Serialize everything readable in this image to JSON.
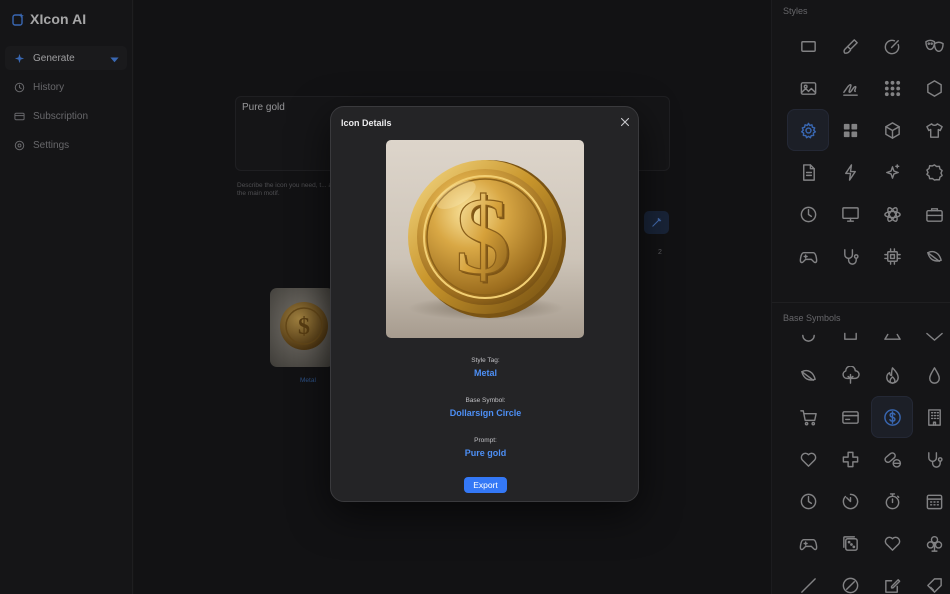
{
  "app": {
    "name": "XIcon AI",
    "icon": "app-logo-icon"
  },
  "sidebar": {
    "items": [
      {
        "label": "Generate",
        "icon": "sparkle-icon",
        "active": true
      },
      {
        "label": "History",
        "icon": "clock-history-icon",
        "active": false
      },
      {
        "label": "Subscription",
        "icon": "credit-card-icon",
        "active": false
      },
      {
        "label": "Settings",
        "icon": "gear-icon",
        "active": false
      }
    ]
  },
  "main": {
    "prompt_value": "Pure gold",
    "hint_text": "Describe the icon you need, t... as the main motif.",
    "count_label": "2",
    "result": {
      "label": "Metal"
    }
  },
  "right_panel": {
    "styles_title": "Styles",
    "styles_selected": "gear-icon",
    "base_symbols_title": "Base Symbols",
    "base_symbols_selected": "dollarsign-circle-icon"
  },
  "modal": {
    "title": "Icon Details",
    "style_tag_label": "Style Tag:",
    "style_tag_value": "Metal",
    "base_symbol_label": "Base Symbol:",
    "base_symbol_value": "Dollarsign Circle",
    "prompt_label": "Prompt:",
    "prompt_value": "Pure gold",
    "export_label": "Export"
  },
  "colors": {
    "accent": "#3478f6",
    "accent_text": "#4d8ff5",
    "background": "#1c1c1e",
    "modal_bg": "#242426"
  }
}
